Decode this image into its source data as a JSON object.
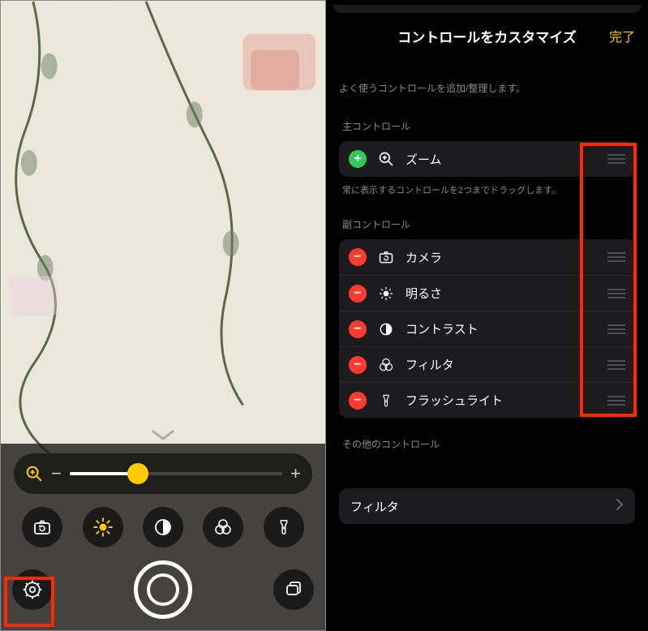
{
  "header": {
    "title": "コントロールをカスタマイズ",
    "done": "完了"
  },
  "hint": "よく使うコントロールを追加/整理します。",
  "main_section": {
    "label": "主コントロール",
    "items": [
      {
        "label": "ズーム",
        "icon": "zoom-in-icon"
      }
    ],
    "sub_hint": "常に表示するコントロールを2つまでドラッグします。"
  },
  "sub_section": {
    "label": "副コントロール",
    "items": [
      {
        "label": "カメラ",
        "icon": "camera-flip-icon"
      },
      {
        "label": "明るさ",
        "icon": "brightness-icon"
      },
      {
        "label": "コントラスト",
        "icon": "contrast-icon"
      },
      {
        "label": "フィルタ",
        "icon": "filter-icon"
      },
      {
        "label": "フラッシュライト",
        "icon": "flashlight-icon"
      }
    ]
  },
  "other_section": {
    "label": "その他のコントロール"
  },
  "filter_row": {
    "label": "フィルタ"
  },
  "left_toolbar": {
    "icons": [
      "camera-flip",
      "brightness",
      "contrast",
      "filter",
      "flashlight"
    ],
    "bottom": [
      "settings",
      "shutter",
      "multiwindow"
    ]
  },
  "colors": {
    "accent": "#ffcc00",
    "danger": "#ff3b30",
    "highlight": "#ff2a00"
  }
}
